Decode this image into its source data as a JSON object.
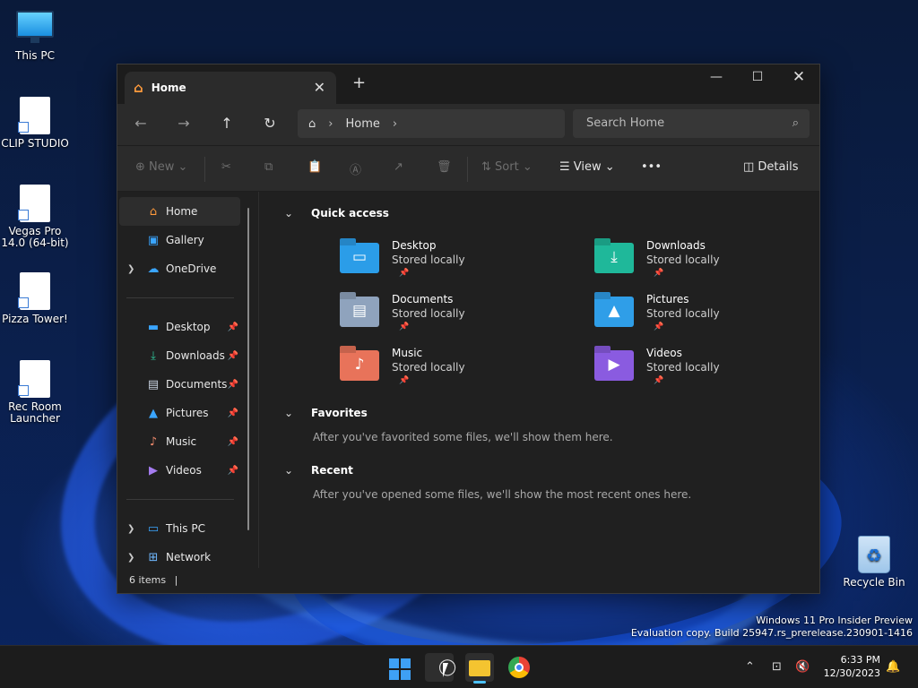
{
  "desktop": {
    "icons": [
      {
        "label": "This PC"
      },
      {
        "label": "CLIP STUDIO"
      },
      {
        "label": "Vegas Pro 14.0 (64-bit)"
      },
      {
        "label": "Pizza Tower!"
      },
      {
        "label": "Rec Room Launcher"
      },
      {
        "label": "Recycle Bin"
      }
    ],
    "watermark": {
      "line1": "Windows 11 Pro Insider Preview",
      "line2": "Evaluation copy. Build 25947.rs_prerelease.230901-1416"
    }
  },
  "window": {
    "tab": {
      "title": "Home"
    },
    "controls": {
      "minimize": "—",
      "maximize": "☐",
      "close": "✕"
    },
    "address": {
      "crumb": "Home"
    },
    "search": {
      "placeholder": "Search Home"
    },
    "toolbar": {
      "new_label": "New",
      "sort_label": "Sort",
      "view_label": "View",
      "more_label": "•••",
      "details_label": "Details"
    },
    "sidebar": {
      "top": [
        {
          "label": "Home"
        },
        {
          "label": "Gallery"
        },
        {
          "label": "OneDrive"
        }
      ],
      "pinned": [
        {
          "label": "Desktop"
        },
        {
          "label": "Downloads"
        },
        {
          "label": "Documents"
        },
        {
          "label": "Pictures"
        },
        {
          "label": "Music"
        },
        {
          "label": "Videos"
        }
      ],
      "bottom": [
        {
          "label": "This PC"
        },
        {
          "label": "Network"
        }
      ]
    },
    "content": {
      "quick_access": {
        "title": "Quick access",
        "items": [
          {
            "name": "Desktop",
            "status": "Stored locally",
            "color": "#2b9de8"
          },
          {
            "name": "Downloads",
            "status": "Stored locally",
            "color": "#1fb89a"
          },
          {
            "name": "Documents",
            "status": "Stored locally",
            "color": "#8fa3bd"
          },
          {
            "name": "Pictures",
            "status": "Stored locally",
            "color": "#2f9ee8"
          },
          {
            "name": "Music",
            "status": "Stored locally",
            "color": "#e8735a"
          },
          {
            "name": "Videos",
            "status": "Stored locally",
            "color": "#8a5be0"
          }
        ]
      },
      "favorites": {
        "title": "Favorites",
        "note": "After you've favorited some files, we'll show them here."
      },
      "recent": {
        "title": "Recent",
        "note": "After you've opened some files, we'll show the most recent ones here."
      }
    },
    "status": {
      "items": "6 items"
    }
  },
  "taskbar": {
    "clock_time": "6:33 PM",
    "clock_date": "12/30/2023"
  }
}
